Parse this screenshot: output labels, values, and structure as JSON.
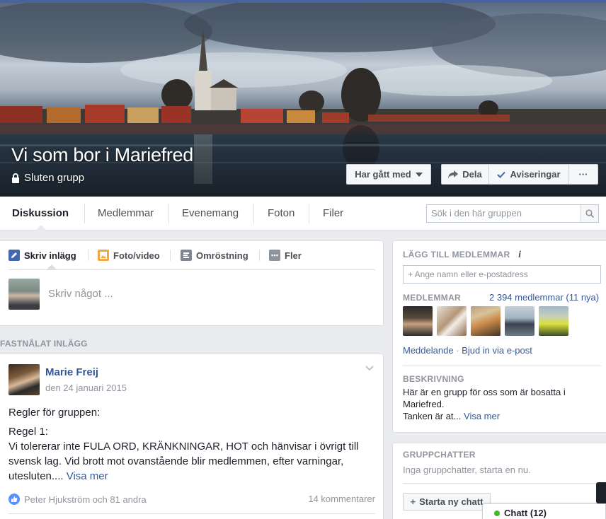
{
  "group": {
    "title": "Vi som bor i Mariefred",
    "privacy": "Sluten grupp"
  },
  "cover_actions": {
    "joined": "Har gått med",
    "share": "Dela",
    "notifications": "Aviseringar",
    "more": "···"
  },
  "tabs": [
    {
      "label": "Diskussion",
      "active": true
    },
    {
      "label": "Medlemmar"
    },
    {
      "label": "Evenemang"
    },
    {
      "label": "Foton"
    },
    {
      "label": "Filer"
    }
  ],
  "search": {
    "placeholder": "Sök i den här gruppen"
  },
  "composer": {
    "tabs": [
      "Skriv inlägg",
      "Foto/video",
      "Omröstning",
      "Fler"
    ],
    "placeholder": "Skriv något ..."
  },
  "pinned": {
    "label": "FASTNÅLAT INLÄGG",
    "author": "Marie Freij",
    "date": "den 24 januari 2015",
    "paragraphs": [
      "Regler för gruppen:",
      "Regel 1:"
    ],
    "body": "Vi tolererar inte FULA ORD, KRÄNKNINGAR, HOT och hänvisar i övrigt till svensk lag. Vid brott mot ovanstående blir medlemmen, efter varningar, utesluten....",
    "see_more": "Visa mer",
    "likes": "Peter Hjukström och 81 andra",
    "comments": "14 kommentarer"
  },
  "sidebar": {
    "add_members": {
      "heading": "LÄGG TILL MEDLEMMAR",
      "info_icon": "i",
      "placeholder": "+ Ange namn eller e-postadress"
    },
    "members": {
      "heading": "MEDLEMMAR",
      "count": "2 394 medlemmar (11 nya)",
      "message": "Meddelande",
      "separator": "·",
      "invite": "Bjud in via e-post"
    },
    "description": {
      "heading": "BESKRIVNING",
      "text": "Här är en grupp för oss som är bosatta i Mariefred.",
      "more_text": "Tanken är at...",
      "see_more": "Visa mer"
    },
    "group_chats": {
      "heading": "GRUPPCHATTER",
      "empty": "Inga gruppchatter, starta en nu.",
      "new_chat": "Starta ny chatt"
    }
  },
  "chat": {
    "label": "Chatt (12)"
  },
  "colors": {
    "link": "#365899",
    "fb_blue": "#4267b2",
    "online": "#42b72a"
  }
}
